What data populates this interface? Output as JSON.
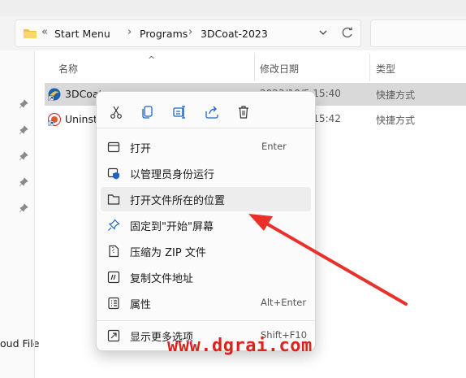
{
  "address_bar": {
    "breadcrumb": [
      "«",
      "Start Menu",
      "Programs",
      "3DCoat-2023"
    ],
    "separator": "›"
  },
  "columns": {
    "name": "名称",
    "modified": "修改日期",
    "type": "类型"
  },
  "files": [
    {
      "name": "3DCoat",
      "date": "2023/10/5 15:40",
      "type": "快捷方式",
      "selected": true
    },
    {
      "name": "Uninst",
      "date": "2023/10/5 15:42",
      "type": "快捷方式",
      "selected": false
    }
  ],
  "nav": {
    "partial_label": "oud File"
  },
  "context_menu": {
    "quick_actions": [
      "cut-icon",
      "copy-icon",
      "rename-icon",
      "share-icon",
      "delete-icon"
    ],
    "items": [
      {
        "label": "打开",
        "shortcut": "Enter",
        "icon": "open-app-icon"
      },
      {
        "label": "以管理员身份运行",
        "shortcut": "",
        "icon": "shield-icon"
      },
      {
        "label": "打开文件所在的位置",
        "shortcut": "",
        "icon": "folder-icon",
        "highlighted": true
      },
      {
        "label": "固定到\"开始\"屏幕",
        "shortcut": "",
        "icon": "pin-icon"
      },
      {
        "label": "压缩为 ZIP 文件",
        "shortcut": "",
        "icon": "zip-icon"
      },
      {
        "label": "复制文件地址",
        "shortcut": "",
        "icon": "copy-path-icon"
      },
      {
        "label": "属性",
        "shortcut": "Alt+Enter",
        "icon": "properties-icon"
      },
      {
        "label": "显示更多选项",
        "shortcut": "Shift+F10",
        "icon": "more-options-icon"
      }
    ]
  },
  "watermark": "www.dgrai.com",
  "colors": {
    "accent": "#1e63c6",
    "annotation_red": "#e8312a",
    "selection": "#d9d9d9"
  }
}
